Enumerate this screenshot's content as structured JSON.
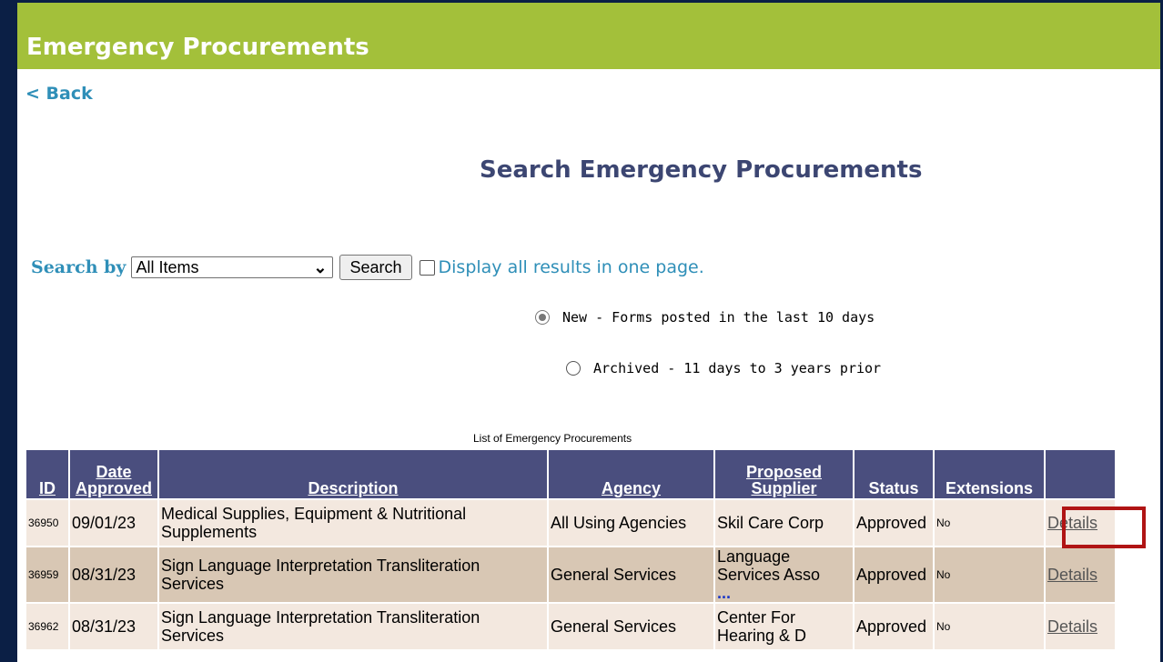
{
  "banner": {
    "title": "Emergency Procurements"
  },
  "nav": {
    "back_label": "< Back"
  },
  "heading": "Search Emergency Procurements",
  "search": {
    "label": "Search by",
    "selected": "All Items",
    "button_label": "Search",
    "display_all_label": "Display all results in one page."
  },
  "filters": [
    {
      "label": "New - Forms posted in the last 10 days",
      "checked": true
    },
    {
      "label": "Archived - 11 days to 3 years prior",
      "checked": false
    }
  ],
  "table": {
    "caption": "List of Emergency Procurements",
    "headers": {
      "id": "ID",
      "date_line1": "Date",
      "date_line2": "Approved",
      "description": "Description",
      "agency": "Agency",
      "supplier_line1": "Proposed",
      "supplier_line2": "Supplier",
      "status": "Status",
      "extensions": "Extensions"
    },
    "rows": [
      {
        "id": "36950",
        "date": "09/01/23",
        "description": "Medical Supplies, Equipment & Nutritional Supplements",
        "agency": "All Using Agencies",
        "supplier": "Skil Care Corp",
        "supplier_more": "",
        "status": "Approved",
        "extensions": "No",
        "details": "Details"
      },
      {
        "id": "36959",
        "date": "08/31/23",
        "description": "Sign Language Interpretation Transliteration Services",
        "agency": "General Services",
        "supplier": "Language Services Asso",
        "supplier_more": "...",
        "status": "Approved",
        "extensions": "No",
        "details": "Details"
      },
      {
        "id": "36962",
        "date": "08/31/23",
        "description": "Sign Language Interpretation Transliteration Services",
        "agency": "General Services",
        "supplier": "Center For Hearing & D",
        "supplier_more": "",
        "status": "Approved",
        "extensions": "No",
        "details": "Details"
      }
    ]
  },
  "colors": {
    "banner": "#a3c03a",
    "header_bg": "#4a4e7e",
    "row_light": "#f3e8df",
    "row_dark": "#d8c7b4",
    "highlight_box": "#b01414"
  },
  "icons": {
    "select_chevron": "chevron-down-icon",
    "radio": "radio-icon",
    "checkbox": "checkbox-icon"
  }
}
